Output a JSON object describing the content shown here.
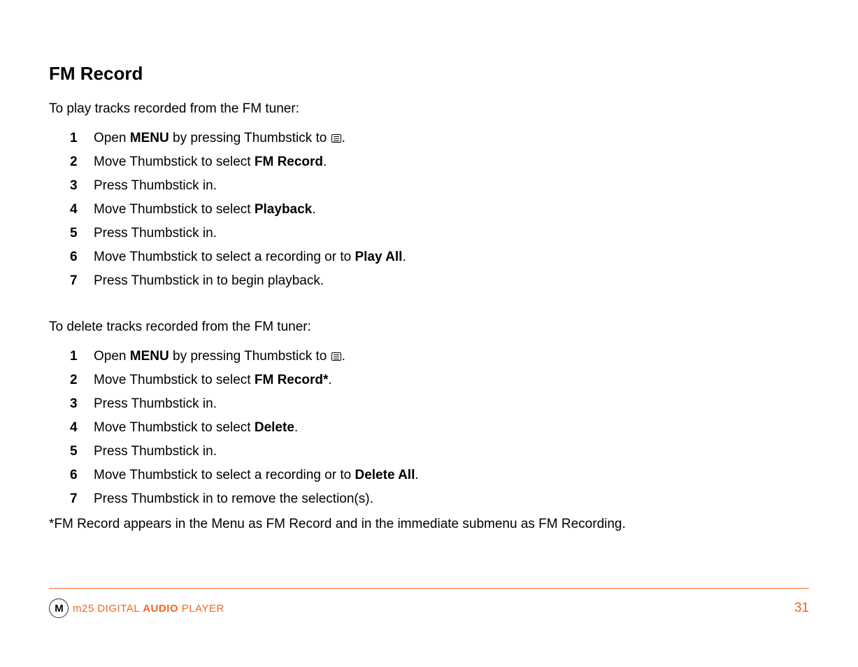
{
  "title": "FM Record",
  "intro1": "To play tracks recorded from the FM tuner:",
  "steps1": [
    {
      "num": "1",
      "pre": "Open ",
      "bold": "MENU",
      "post": " by pressing Thumbstick to ",
      "icon": true,
      "tail": "."
    },
    {
      "num": "2",
      "pre": "Move Thumbstick to select ",
      "bold": "FM Record",
      "post": "."
    },
    {
      "num": "3",
      "pre": "Press Thumbstick in.",
      "bold": "",
      "post": ""
    },
    {
      "num": "4",
      "pre": "Move Thumbstick to select ",
      "bold": "Playback",
      "post": "."
    },
    {
      "num": "5",
      "pre": "Press Thumbstick in.",
      "bold": "",
      "post": ""
    },
    {
      "num": "6",
      "pre": "Move Thumbstick to select a recording or to ",
      "bold": "Play All",
      "post": "."
    },
    {
      "num": "7",
      "pre": "Press Thumbstick in to begin playback.",
      "bold": "",
      "post": ""
    }
  ],
  "intro2": "To delete tracks recorded from the FM tuner:",
  "steps2": [
    {
      "num": "1",
      "pre": "Open ",
      "bold": "MENU",
      "post": " by pressing Thumbstick to ",
      "icon": true,
      "tail": "."
    },
    {
      "num": "2",
      "pre": "Move Thumbstick to select ",
      "bold": "FM Record*",
      "post": "."
    },
    {
      "num": "3",
      "pre": "Press Thumbstick in.",
      "bold": "",
      "post": ""
    },
    {
      "num": "4",
      "pre": "Move Thumbstick to select ",
      "bold": "Delete",
      "post": "."
    },
    {
      "num": "5",
      "pre": "Press Thumbstick in.",
      "bold": "",
      "post": ""
    },
    {
      "num": "6",
      "pre": "Move Thumbstick to select a recording or to ",
      "bold": "Delete All",
      "post": "."
    },
    {
      "num": "7",
      "pre": "Press Thumbstick in to remove the selection(s).",
      "bold": "",
      "post": ""
    }
  ],
  "footnote": "*FM Record appears in the Menu as FM Record and in the immediate submenu as FM Recording.",
  "footer": {
    "logo_letter": "M",
    "prefix": "m25 DIGITAL ",
    "bold": "AUDIO",
    "suffix": " PLAYER",
    "page": "31"
  }
}
